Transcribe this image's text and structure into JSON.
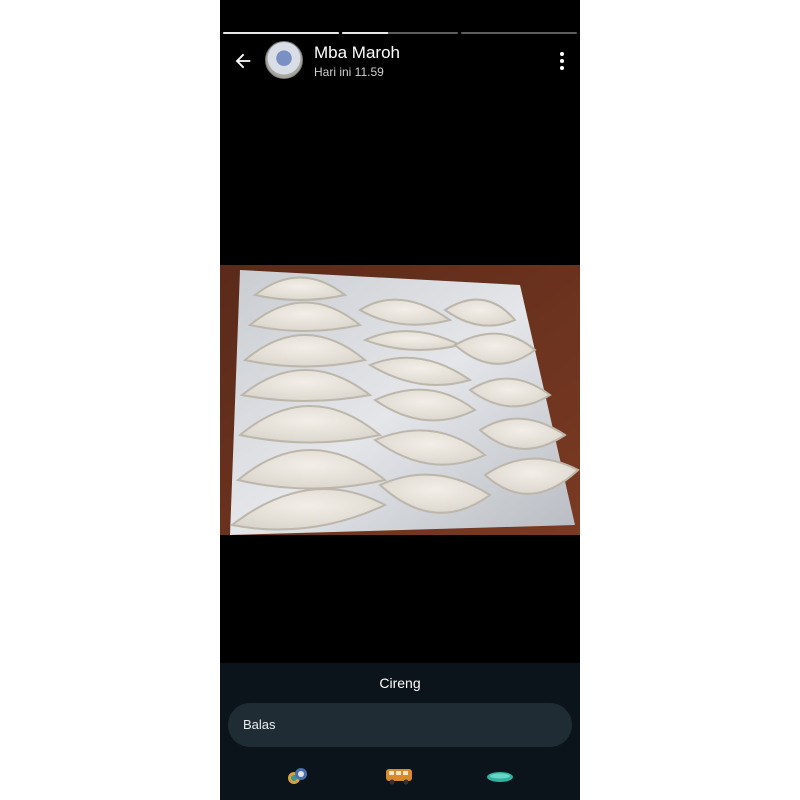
{
  "status": {
    "contact_name": "Mba Maroh",
    "timestamp": "Hari ini 11.59",
    "segments": [
      {
        "progress": 1.0
      },
      {
        "progress": 0.4
      },
      {
        "progress": 0.0
      }
    ]
  },
  "caption": "Cireng",
  "reply": {
    "placeholder": "Balas"
  },
  "bottom_icons": [
    "sticker-rings-icon",
    "van-icon",
    "surfboard-icon"
  ],
  "colors": {
    "background": "#000000",
    "panel": "#0b141a",
    "input": "#1f2c34"
  }
}
